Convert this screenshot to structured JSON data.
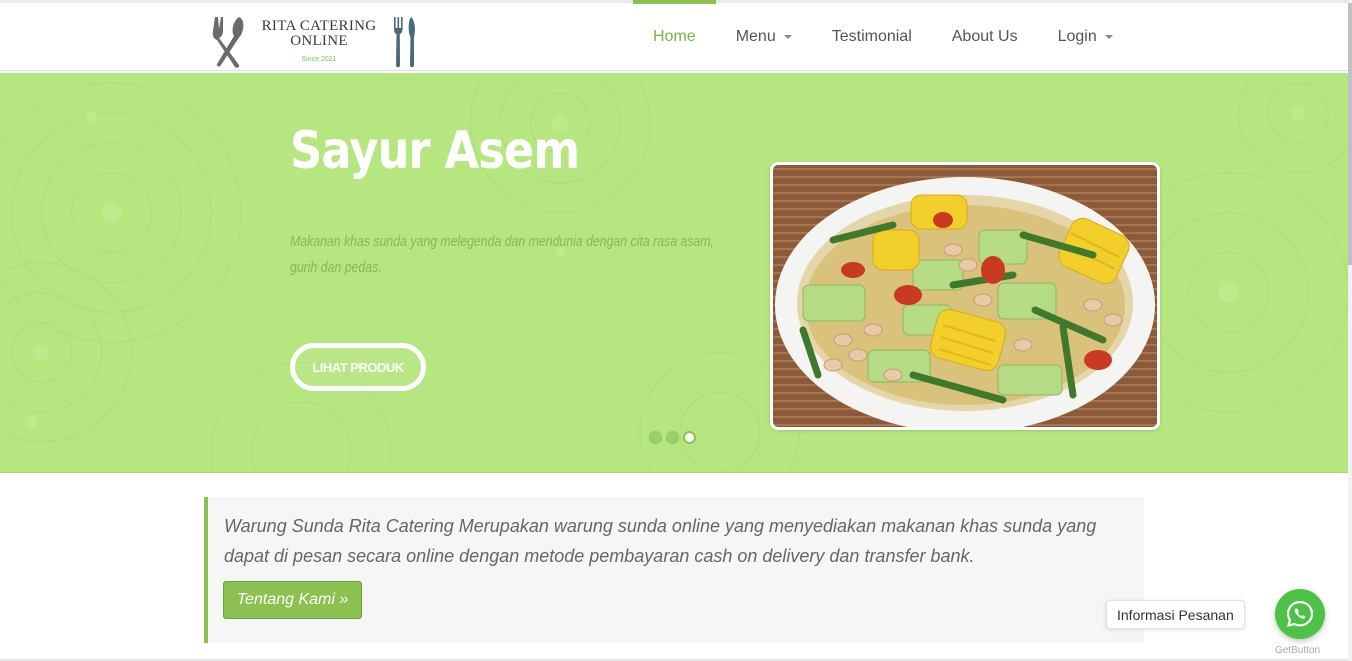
{
  "brand": {
    "name_line1": "RITA CATERING",
    "name_line2": "ONLINE",
    "since": "Since 2021"
  },
  "nav": {
    "items": [
      {
        "label": "Home",
        "active": true,
        "dropdown": false
      },
      {
        "label": "Menu",
        "active": false,
        "dropdown": true
      },
      {
        "label": "Testimonial",
        "active": false,
        "dropdown": false
      },
      {
        "label": "About Us",
        "active": false,
        "dropdown": false
      },
      {
        "label": "Login",
        "active": false,
        "dropdown": true
      }
    ]
  },
  "hero": {
    "title": "Sayur Asem",
    "description": "Makanan khas sunda yang melegenda dan mendunia dengan cita rasa asam, gurih dan pedas.",
    "button_label": "LIHAT PRODUK",
    "slide_count": 3,
    "active_slide": 3,
    "background_color": "#b5e680"
  },
  "intro": {
    "text": "Warung Sunda Rita Catering Merupakan warung sunda online yang menyediakan makanan khas sunda yang dapat di pesan secara online dengan metode pembayaran cash on delivery dan transfer bank.",
    "button_label": "Tentang Kami »"
  },
  "widget": {
    "label": "Informasi Pesanan",
    "icon": "whatsapp-icon",
    "credit": "GetButton"
  },
  "colors": {
    "accent": "#8cc152",
    "whatsapp": "#4dc247"
  }
}
